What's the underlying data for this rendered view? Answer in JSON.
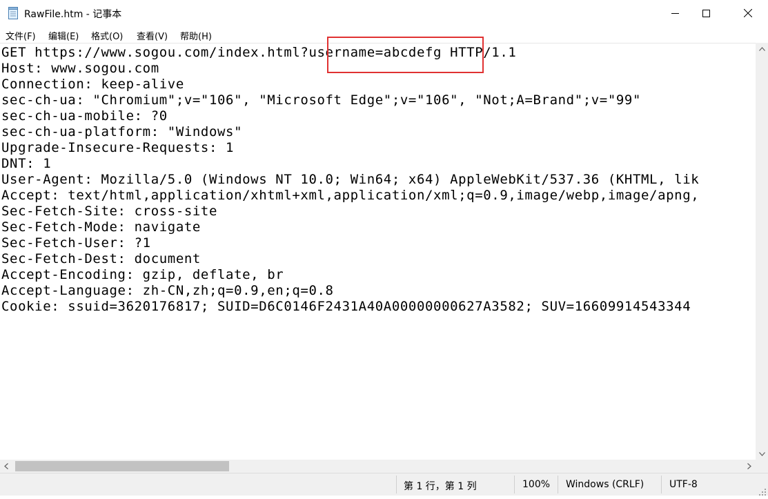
{
  "window": {
    "title": "RawFile.htm - 记事本",
    "app_icon": "notepad-icon"
  },
  "menu": {
    "items": [
      {
        "label": "文件(F)"
      },
      {
        "label": "编辑(E)"
      },
      {
        "label": "格式(O)"
      },
      {
        "label": "查看(V)"
      },
      {
        "label": "帮助(H)"
      }
    ]
  },
  "editor": {
    "lines": [
      "GET https://www.sogou.com/index.html?username=abcdefg HTTP/1.1",
      "Host: www.sogou.com",
      "Connection: keep-alive",
      "sec-ch-ua: \"Chromium\";v=\"106\", \"Microsoft Edge\";v=\"106\", \"Not;A=Brand\";v=\"99\"",
      "sec-ch-ua-mobile: ?0",
      "sec-ch-ua-platform: \"Windows\"",
      "Upgrade-Insecure-Requests: 1",
      "DNT: 1",
      "User-Agent: Mozilla/5.0 (Windows NT 10.0; Win64; x64) AppleWebKit/537.36 (KHTML, lik",
      "Accept: text/html,application/xhtml+xml,application/xml;q=0.9,image/webp,image/apng,",
      "Sec-Fetch-Site: cross-site",
      "Sec-Fetch-Mode: navigate",
      "Sec-Fetch-User: ?1",
      "Sec-Fetch-Dest: document",
      "Accept-Encoding: gzip, deflate, br",
      "Accept-Language: zh-CN,zh;q=0.9,en;q=0.8",
      "Cookie: ssuid=3620176817; SUID=D6C0146F2431A40A00000000627A3582; SUV=16609914543344"
    ],
    "highlight_color": "#e03131"
  },
  "status": {
    "position": "第 1 行，第 1 列",
    "zoom": "100%",
    "line_ending": "Windows (CRLF)",
    "encoding": "UTF-8"
  },
  "icons": {
    "minimize": "minimize-icon",
    "maximize": "maximize-icon",
    "close": "close-icon"
  }
}
